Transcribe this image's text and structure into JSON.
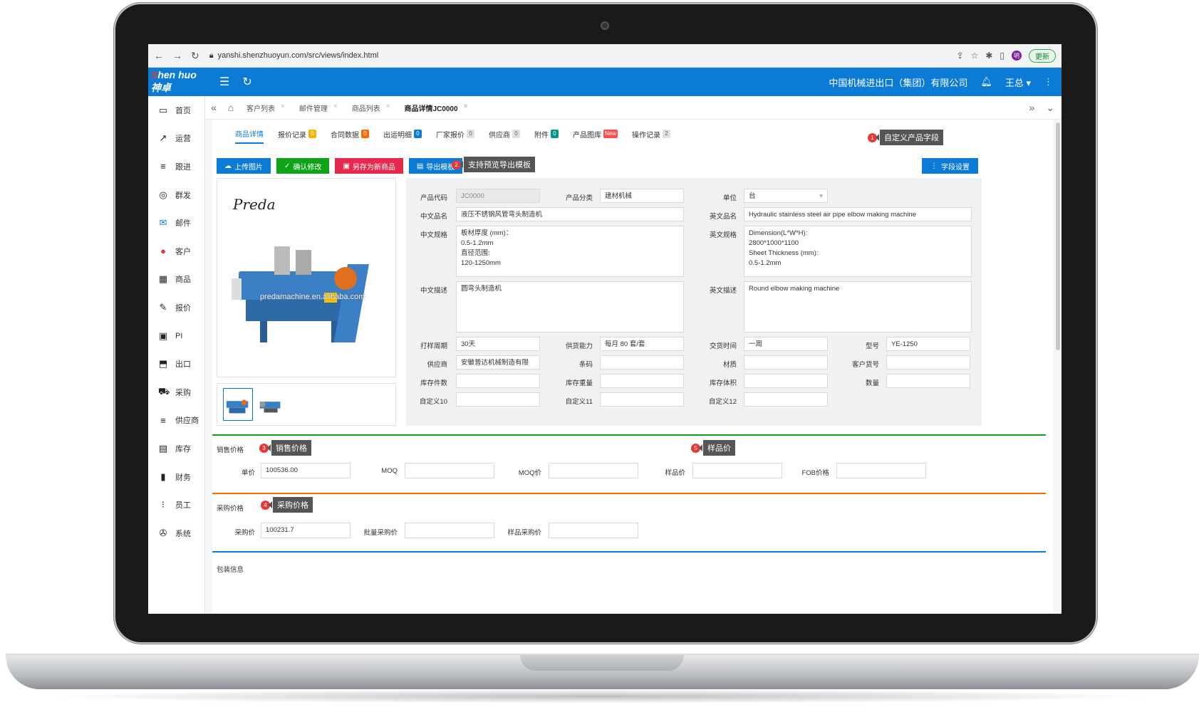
{
  "browser": {
    "url": "yanshi.shenzhuoyun.com/src/views/index.html",
    "update_label": "更新",
    "avatar_initial": "明"
  },
  "topbar": {
    "logo_prefix": "S",
    "logo_text": "hen huo 神卓",
    "company": "中国机械进出口（集团）有限公司",
    "user": "王总 ▾"
  },
  "sidebar": {
    "items": [
      {
        "label": "首页",
        "icon": "monitor-icon"
      },
      {
        "label": "运营",
        "icon": "trend-icon"
      },
      {
        "label": "跟进",
        "icon": "list-icon"
      },
      {
        "label": "群发",
        "icon": "target-icon"
      },
      {
        "label": "邮件",
        "icon": "mail-icon"
      },
      {
        "label": "客户",
        "icon": "user-icon"
      },
      {
        "label": "商品",
        "icon": "grid-icon"
      },
      {
        "label": "报价",
        "icon": "pen-icon"
      },
      {
        "label": "PI",
        "icon": "clipboard-icon"
      },
      {
        "label": "出口",
        "icon": "train-icon"
      },
      {
        "label": "采购",
        "icon": "truck-icon"
      },
      {
        "label": "供应商",
        "icon": "list-icon"
      },
      {
        "label": "库存",
        "icon": "cart-icon"
      },
      {
        "label": "财务",
        "icon": "bar-icon"
      },
      {
        "label": "员工",
        "icon": "dots-icon"
      },
      {
        "label": "系统",
        "icon": "wrench-icon"
      }
    ]
  },
  "tabs": [
    "客户列表",
    "邮件管理",
    "商品列表",
    "商品详情JC0000"
  ],
  "subtabs": [
    {
      "label": "商品详情",
      "badge": ""
    },
    {
      "label": "报价记录",
      "badge": "0"
    },
    {
      "label": "合同数据",
      "badge": "0"
    },
    {
      "label": "出运明细",
      "badge": "0"
    },
    {
      "label": "厂家报价",
      "badge": "0"
    },
    {
      "label": "供应商",
      "badge": "0"
    },
    {
      "label": "附件",
      "badge": "0"
    },
    {
      "label": "产品图库",
      "badge": "New"
    },
    {
      "label": "操作记录",
      "badge": "2"
    }
  ],
  "buttons": {
    "upload": "上传图片",
    "confirm": "确认修改",
    "save_new": "另存为新商品",
    "export": "导出模板",
    "field_settings": "字段设置"
  },
  "callouts": {
    "c1": "自定义产品字段",
    "c2": "支持预览导出模板",
    "c3": "销售价格",
    "c4": "采购价格",
    "c5": "样品价"
  },
  "image": {
    "brand": "Preda",
    "watermark": "predamachine.en.alibaba.com"
  },
  "form": {
    "product_code_label": "产品代码",
    "product_code": "JC0000",
    "category_label": "产品分类",
    "category": "建材机械",
    "unit_label": "单位",
    "unit": "台",
    "cn_name_label": "中文品名",
    "cn_name": "液压不锈钢风管弯头制造机",
    "en_name_label": "英文品名",
    "en_name": "Hydraulic stainless steel air pipe elbow making machine",
    "cn_spec_label": "中文规格",
    "cn_spec": "板材厚度 (mm)：\n0.5-1.2mm\n直径范围:\n120-1250mm",
    "en_spec_label": "英文规格",
    "en_spec": "Dimension(L*W*H):\n2800*1000*1100\nSheet Thickness (mm):\n0.5-1.2mm",
    "cn_desc_label": "中文描述",
    "cn_desc": "圆弯头制造机",
    "en_desc_label": "英文描述",
    "en_desc": "Round elbow making machine",
    "sample_cycle_label": "打样周期",
    "sample_cycle": "30天",
    "supply_label": "供货能力",
    "supply": "每月 80 套/套",
    "delivery_label": "交货时间",
    "delivery": "一周",
    "model_label": "型号",
    "model": "YE-1250",
    "supplier_label": "供应商",
    "supplier": "安徽普达机械制造有限公司",
    "barcode_label": "条码",
    "material_label": "材质",
    "cust_no_label": "客户货号",
    "stock_count_label": "库存件数",
    "stock_weight_label": "库存重量",
    "stock_volume_label": "库存体积",
    "qty_label": "数量",
    "custom10_label": "自定义10",
    "custom11_label": "自定义11",
    "custom12_label": "自定义12"
  },
  "sales": {
    "section": "销售价格",
    "unit_price_label": "单价",
    "unit_price": "100536.00",
    "moq_label": "MOQ",
    "moq_price_label": "MOQ价",
    "sample_price_label": "样品价",
    "fob_label": "FOB价格"
  },
  "purchase": {
    "section": "采购价格",
    "price_label": "采购价",
    "price": "100231.7",
    "bulk_label": "批量采购价",
    "sample_label": "样品采购价"
  },
  "packing": {
    "section": "包装信息"
  },
  "colors": {
    "primary": "#0b7bd6",
    "green_line": "#10a31a",
    "orange_line": "#ff6a00",
    "blue_line": "#0b7bd6"
  }
}
